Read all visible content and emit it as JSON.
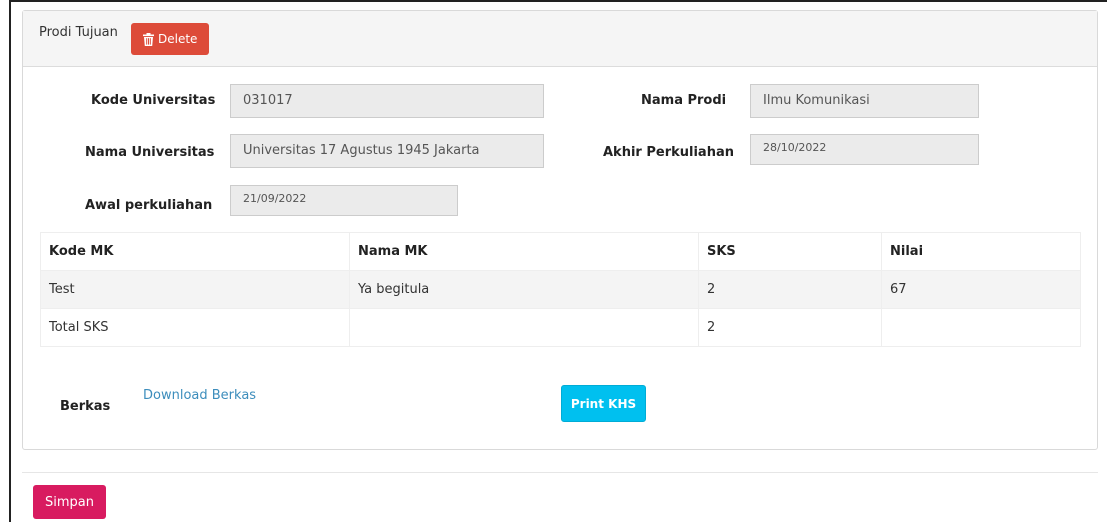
{
  "panel": {
    "title": "Prodi Tujuan",
    "delete_label": "Delete"
  },
  "form": {
    "kode_universitas": {
      "label": "Kode Universitas",
      "value": "031017"
    },
    "nama_universitas": {
      "label": "Nama Universitas",
      "value": "Universitas 17 Agustus 1945 Jakarta"
    },
    "awal_perkuliahan": {
      "label": "Awal perkuliahan",
      "value": "21/09/2022"
    },
    "nama_prodi": {
      "label": "Nama Prodi",
      "value": "Ilmu Komunikasi"
    },
    "akhir_perkuliahan": {
      "label": "Akhir Perkuliahan",
      "value": "28/10/2022"
    }
  },
  "table": {
    "headers": [
      "Kode MK",
      "Nama MK",
      "SKS",
      "Nilai"
    ],
    "rows": [
      [
        "Test",
        "Ya begitula",
        "2",
        "67"
      ]
    ],
    "total_label": "Total SKS",
    "total_sks": "2"
  },
  "berkas": {
    "label": "Berkas",
    "link": "Download Berkas",
    "print_label": "Print KHS"
  },
  "footer": {
    "save_label": "Simpan"
  },
  "colors": {
    "delete": "#dd4b39",
    "print": "#00c0ef",
    "save": "#d81b60",
    "link": "#3c8dbc"
  },
  "icons": {
    "delete": "trash-icon"
  }
}
